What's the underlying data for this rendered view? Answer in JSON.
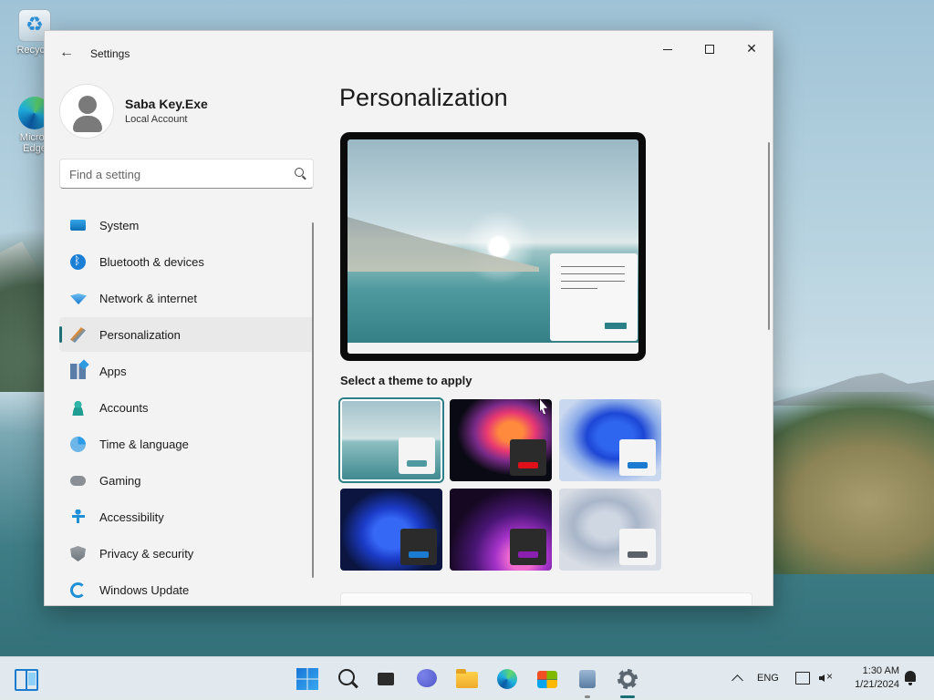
{
  "desktop": {
    "icons": [
      {
        "label": "Recycle",
        "icon": "recycle-bin-icon"
      },
      {
        "label": "Micros Edge",
        "icon": "edge-icon"
      }
    ]
  },
  "window": {
    "title": "Settings",
    "controls": {
      "minimize": "minimize",
      "maximize": "maximize",
      "close": "close"
    }
  },
  "profile": {
    "name": "Saba Key.Exe",
    "account_type": "Local Account"
  },
  "search": {
    "placeholder": "Find a setting"
  },
  "sidebar": {
    "items": [
      {
        "label": "System",
        "icon": "system-icon"
      },
      {
        "label": "Bluetooth & devices",
        "icon": "bluetooth-icon"
      },
      {
        "label": "Network & internet",
        "icon": "network-icon"
      },
      {
        "label": "Personalization",
        "icon": "paintbrush-icon",
        "active": true
      },
      {
        "label": "Apps",
        "icon": "apps-icon"
      },
      {
        "label": "Accounts",
        "icon": "accounts-icon"
      },
      {
        "label": "Time & language",
        "icon": "time-language-icon"
      },
      {
        "label": "Gaming",
        "icon": "gamepad-icon"
      },
      {
        "label": "Accessibility",
        "icon": "accessibility-icon"
      },
      {
        "label": "Privacy & security",
        "icon": "shield-icon"
      },
      {
        "label": "Windows Update",
        "icon": "update-icon"
      }
    ]
  },
  "main": {
    "title": "Personalization",
    "theme_heading": "Select a theme to apply",
    "themes": [
      {
        "name": "windows-light-spotlight",
        "selected": true,
        "accent": "#4f9aa0"
      },
      {
        "name": "glow",
        "selected": false,
        "accent": "#e0101a"
      },
      {
        "name": "windows-light",
        "selected": false,
        "accent": "#1a7bd0"
      },
      {
        "name": "windows-dark",
        "selected": false,
        "accent": "#1a7bd0"
      },
      {
        "name": "captured-motion",
        "selected": false,
        "accent": "#8a1fb0"
      },
      {
        "name": "flow",
        "selected": false,
        "accent": "#5a6169"
      }
    ]
  },
  "taskbar": {
    "apps": [
      "widgets",
      "start",
      "search",
      "task-view",
      "chat",
      "file-explorer",
      "edge",
      "store",
      "app",
      "settings"
    ],
    "language": "ENG",
    "time": "1:30 AM",
    "date": "1/21/2024"
  },
  "colors": {
    "accent": "#1d6f75"
  }
}
